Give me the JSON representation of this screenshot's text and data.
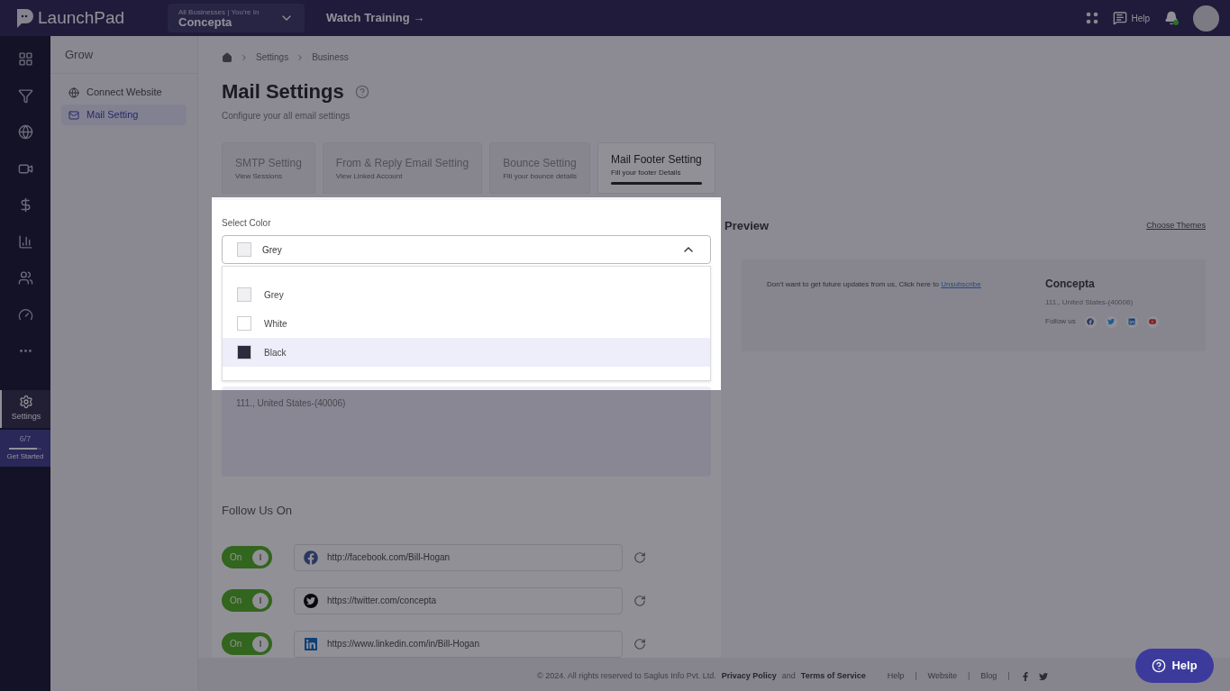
{
  "top_bar": {
    "logo": "LaunchPad",
    "business_switcher": {
      "caption": "All Businesses | You're In",
      "value": "Concepta"
    },
    "watch_training": "Watch Training →",
    "help": "Help",
    "notifications": {
      "unread": true
    }
  },
  "rail": {
    "items": [
      {
        "kind": "grid",
        "selected": false
      },
      {
        "kind": "funnel",
        "selected": false
      },
      {
        "kind": "globe",
        "selected": false
      },
      {
        "kind": "video",
        "selected": false
      },
      {
        "kind": "dollar",
        "selected": false
      },
      {
        "kind": "chart",
        "selected": false
      },
      {
        "kind": "people",
        "selected": false
      },
      {
        "kind": "gauge",
        "selected": false
      },
      {
        "kind": "more",
        "selected": false
      },
      {
        "kind": "settings",
        "label": "Settings",
        "selected": true
      }
    ],
    "progress": {
      "count": "6/7",
      "level": 0.85,
      "label": "Get Started"
    }
  },
  "sidebar": {
    "title": "Grow",
    "items": [
      {
        "kind": "website",
        "label": "Connect Website",
        "selected": false
      },
      {
        "kind": "mail",
        "label": "Mail Setting",
        "selected": true
      }
    ]
  },
  "breadcrumb": [
    "Settings",
    "Business"
  ],
  "page": {
    "title": "Mail Settings",
    "subtitle": "Configure your all email settings"
  },
  "tabs": [
    {
      "label": "SMTP Setting",
      "caption": "View Sessions",
      "selected": false
    },
    {
      "label": "From & Reply Email Setting",
      "caption": "View Linked Account",
      "selected": false
    },
    {
      "label": "Bounce Setting",
      "caption": "Fill your bounce details",
      "selected": false
    },
    {
      "label": "Mail Footer Setting",
      "caption": "Fill your footer Details",
      "selected": true
    }
  ],
  "color_select": {
    "label": "Select Color",
    "value": {
      "label": "Grey",
      "color": "#f0f0f3"
    },
    "expanded": true,
    "options": [
      {
        "label": "Grey",
        "color": "#f0f0f3",
        "highlighted": false
      },
      {
        "label": "White",
        "color": "#ffffff",
        "highlighted": false
      },
      {
        "label": "Black",
        "color": "#2c2a3c",
        "highlighted": true
      }
    ]
  },
  "address": "111., United States-(40006)",
  "follow": {
    "title": "Follow Us On",
    "rows": [
      {
        "kind": "facebook",
        "on": true,
        "toggle_label": "On",
        "url": "http://facebook.com/Bill-Hogan"
      },
      {
        "kind": "twitter",
        "on": true,
        "toggle_label": "On",
        "url": "https://twitter.com/concepta"
      },
      {
        "kind": "linkedin",
        "on": true,
        "toggle_label": "On",
        "url": "https://www.linkedin.com/in/Bill-Hogan"
      }
    ]
  },
  "preview": {
    "title": "Preview",
    "choose_themes": "Choose Themes",
    "unsubscribe_text": "Don't want to get future updates from us, Click here to",
    "unsubscribe_link": "Unsubscribe",
    "company": "Concepta",
    "address": "111., United States-(40006)",
    "follow_label": "Follow us",
    "socials": [
      {
        "kind": "facebook"
      },
      {
        "kind": "twitter"
      },
      {
        "kind": "linkedin"
      },
      {
        "kind": "youtube"
      }
    ]
  },
  "footer": {
    "copyright": "©  2024. All rights reserved to Saglus Info Pvt. Ltd.",
    "privacy": "Privacy Policy",
    "and": "and",
    "terms": "Terms of Service",
    "items": [
      {
        "kind": "link",
        "text": "Help"
      },
      {
        "kind": "separator",
        "text": "|"
      },
      {
        "kind": "link",
        "text": "Website"
      },
      {
        "kind": "separator",
        "text": "|"
      },
      {
        "kind": "link",
        "text": "Blog"
      },
      {
        "kind": "separator",
        "text": "|"
      },
      {
        "kind": "facebook"
      },
      {
        "kind": "twitter"
      }
    ]
  },
  "help_button": "Help"
}
